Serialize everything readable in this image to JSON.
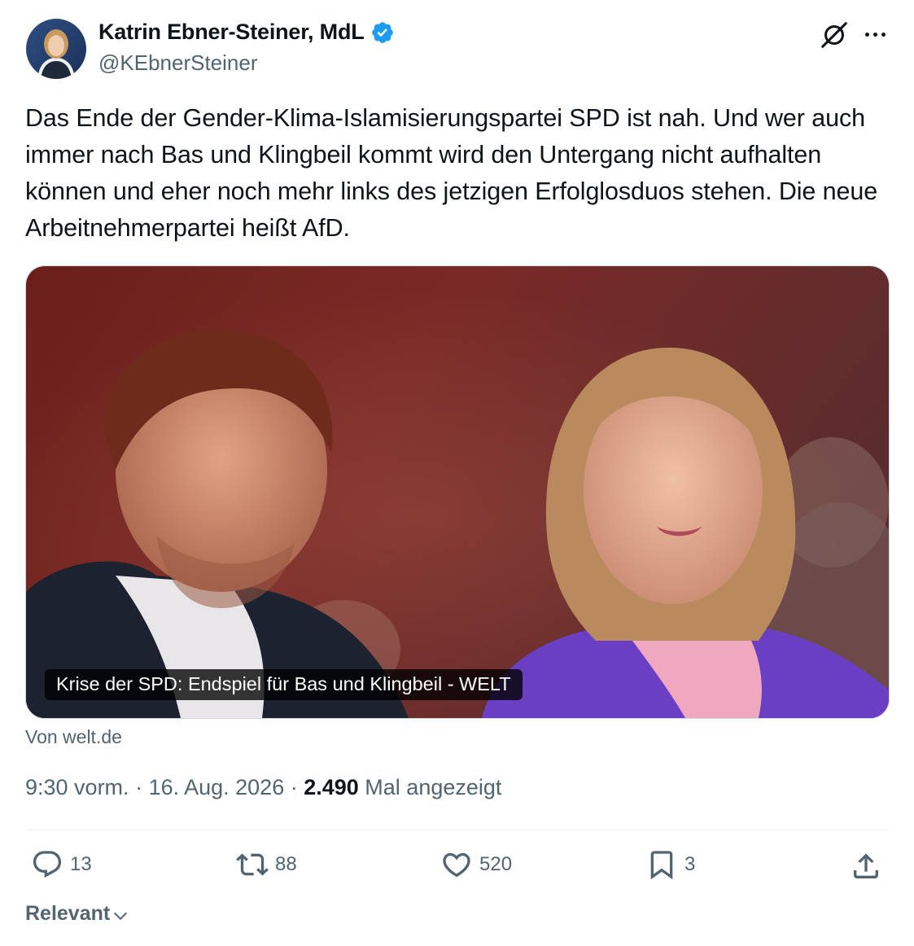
{
  "author": {
    "display_name": "Katrin Ebner-Steiner, MdL",
    "handle": "@KEbnerSteiner",
    "verified": true,
    "verified_color": "#1d9bf0"
  },
  "tweet": {
    "text": "Das Ende der Gender-Klima-Islamisierungspartei SPD ist nah. Und wer auch immer nach Bas und Klingbeil kommt wird den Untergang nicht aufhalten können und eher noch mehr links des jetzigen Erfolglosduos stehen. Die neue Arbeitnehmerpartei heißt AfD."
  },
  "card": {
    "caption": "Krise der SPD: Endspiel für Bas und Klingbeil - WELT",
    "source": "Von welt.de"
  },
  "meta": {
    "time": "9:30 vorm.",
    "separator": " · ",
    "date": "16. Aug. 2026",
    "views_count": "2.490",
    "views_label": " Mal angezeigt"
  },
  "actions": {
    "replies": "13",
    "reposts": "88",
    "likes": "520",
    "bookmarks": "3"
  },
  "sort": {
    "label": "Relevant"
  },
  "icons": {
    "reply": "reply-icon",
    "repost": "repost-icon",
    "like": "heart-icon",
    "bookmark": "bookmark-icon",
    "share": "share-icon",
    "grok": "grok-icon",
    "more": "more-icon",
    "chevron": "chevron-down-icon"
  },
  "colors": {
    "text_primary": "#0f1419",
    "text_secondary": "#536471",
    "accent": "#1d9bf0",
    "divider": "#eff3f4"
  }
}
